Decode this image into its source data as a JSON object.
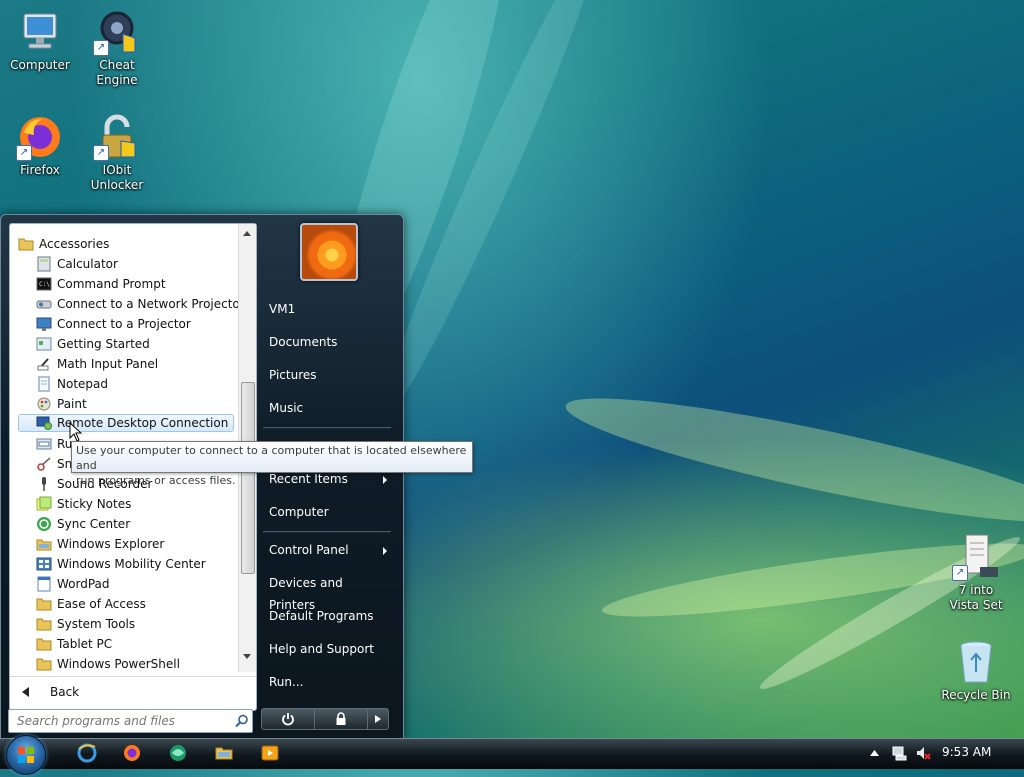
{
  "desktop_icons": [
    {
      "name": "computer",
      "label": "Computer"
    },
    {
      "name": "cheat-engine",
      "label": "Cheat Engine"
    },
    {
      "name": "firefox",
      "label": "Firefox"
    },
    {
      "name": "iobit-unlocker",
      "label": "IObit Unlocker"
    },
    {
      "name": "7-into-vista-set",
      "label": "7 into Vista Set"
    },
    {
      "name": "recycle-bin",
      "label": "Recycle Bin"
    }
  ],
  "start_menu": {
    "programs": [
      {
        "label": "Accessories",
        "icon": "folder-icon"
      },
      {
        "label": "Calculator",
        "icon": "calculator-icon"
      },
      {
        "label": "Command Prompt",
        "icon": "command-prompt-icon"
      },
      {
        "label": "Connect to a Network Projector",
        "icon": "network-projector-icon"
      },
      {
        "label": "Connect to a Projector",
        "icon": "projector-icon"
      },
      {
        "label": "Getting Started",
        "icon": "getting-started-icon"
      },
      {
        "label": "Math Input Panel",
        "icon": "math-input-icon"
      },
      {
        "label": "Notepad",
        "icon": "notepad-icon"
      },
      {
        "label": "Paint",
        "icon": "paint-icon"
      },
      {
        "label": "Remote Desktop Connection",
        "icon": "remote-desktop-icon"
      },
      {
        "label": "Run",
        "icon": "run-icon"
      },
      {
        "label": "Snipping Tool",
        "icon": "snipping-tool-icon"
      },
      {
        "label": "Sound Recorder",
        "icon": "microphone-icon"
      },
      {
        "label": "Sticky Notes",
        "icon": "sticky-notes-icon"
      },
      {
        "label": "Sync Center",
        "icon": "sync-center-icon"
      },
      {
        "label": "Windows Explorer",
        "icon": "explorer-icon"
      },
      {
        "label": "Windows Mobility Center",
        "icon": "mobility-center-icon"
      },
      {
        "label": "WordPad",
        "icon": "wordpad-icon"
      },
      {
        "label": "Ease of Access",
        "icon": "folder-icon"
      },
      {
        "label": "System Tools",
        "icon": "folder-icon"
      },
      {
        "label": "Tablet PC",
        "icon": "folder-icon"
      },
      {
        "label": "Windows PowerShell",
        "icon": "folder-icon"
      }
    ],
    "selected_program": "Remote Desktop Connection",
    "back_label": "Back",
    "search_placeholder": "Search programs and files",
    "right_items": {
      "user": "VM1",
      "documents": "Documents",
      "pictures": "Pictures",
      "music": "Music",
      "recent_items": "Recent Items",
      "computer": "Computer",
      "control_panel": "Control Panel",
      "devices_printers": "Devices and Printers",
      "default_programs": "Default Programs",
      "help_support": "Help and Support",
      "run": "Run..."
    }
  },
  "tooltip": {
    "line1": "Use your computer to connect to a computer that is located elsewhere and",
    "line2": "run programs or access files."
  },
  "taskbar": {
    "pinned": [
      "internet-explorer-icon",
      "firefox-icon",
      "media-center-icon",
      "explorer-folder-icon",
      "media-player-icon"
    ],
    "clock": "9:53 AM"
  },
  "colors": {
    "taskbar": "#121a20",
    "start_menu": "#0e1c27",
    "selection": "#d7e9f9"
  }
}
